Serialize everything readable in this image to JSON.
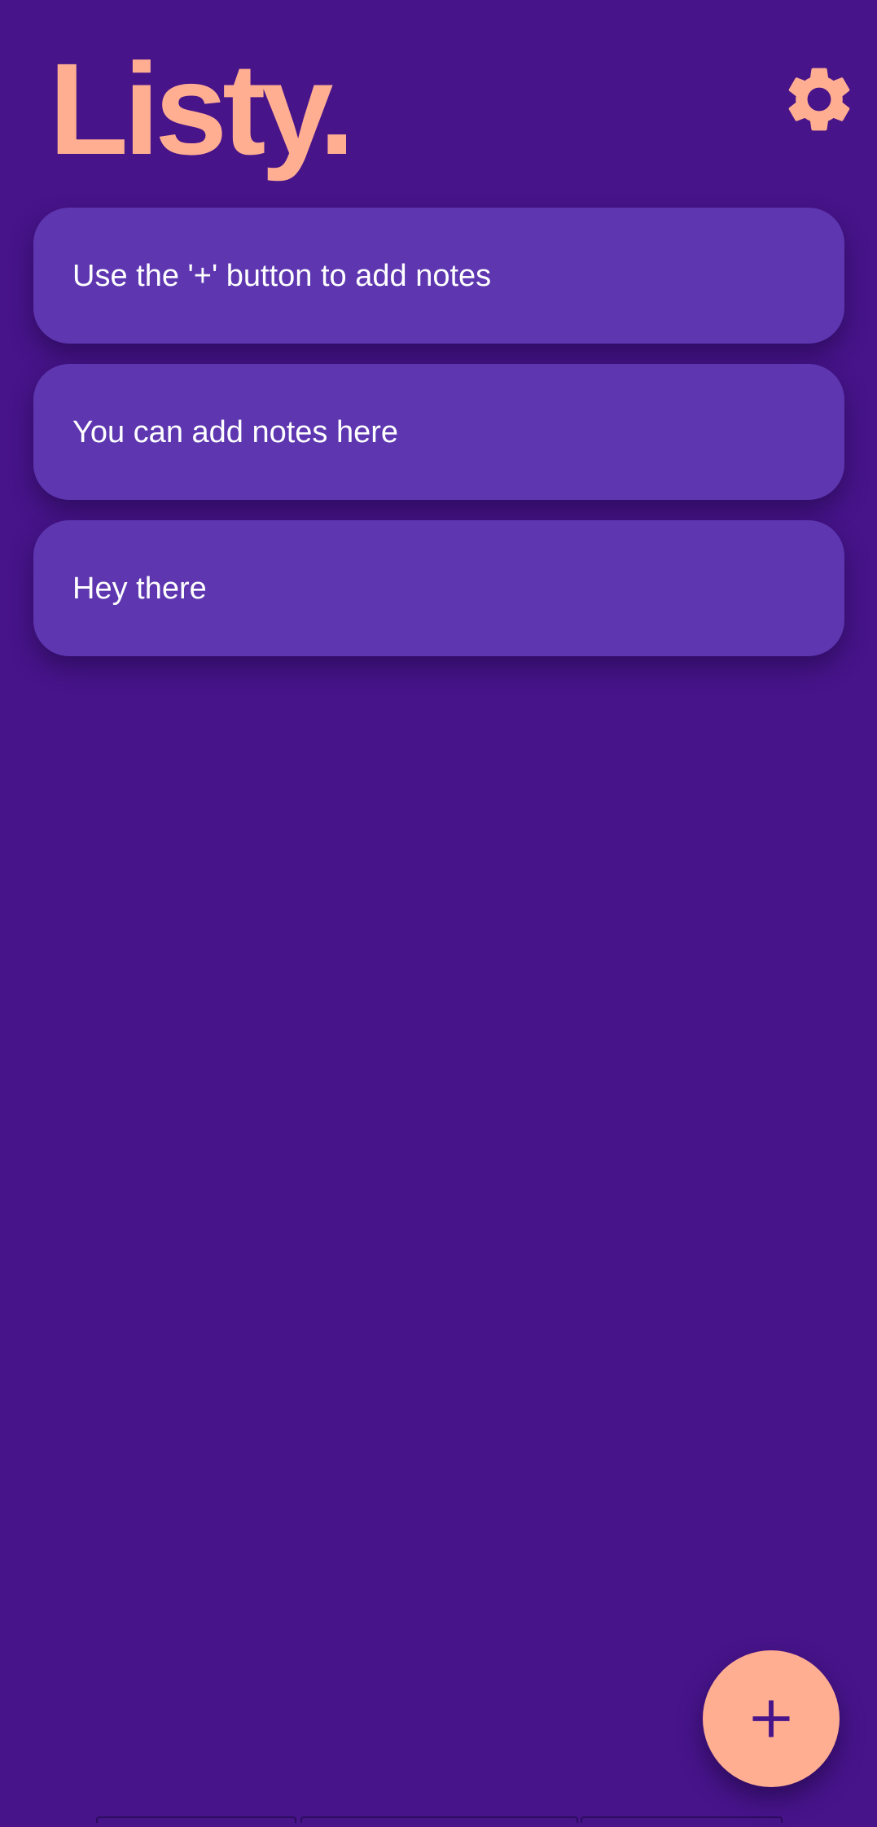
{
  "app": {
    "title": "Listy."
  },
  "header": {
    "settings_icon": "gear-icon"
  },
  "notes": [
    {
      "text": "Use the '+' button to add notes"
    },
    {
      "text": "You can add notes here"
    },
    {
      "text": "Hey there"
    }
  ],
  "fab": {
    "icon": "plus-icon"
  },
  "colors": {
    "background": "#47148a",
    "card": "#5d36b0",
    "accent": "#ffae91",
    "text": "#ffffff"
  }
}
